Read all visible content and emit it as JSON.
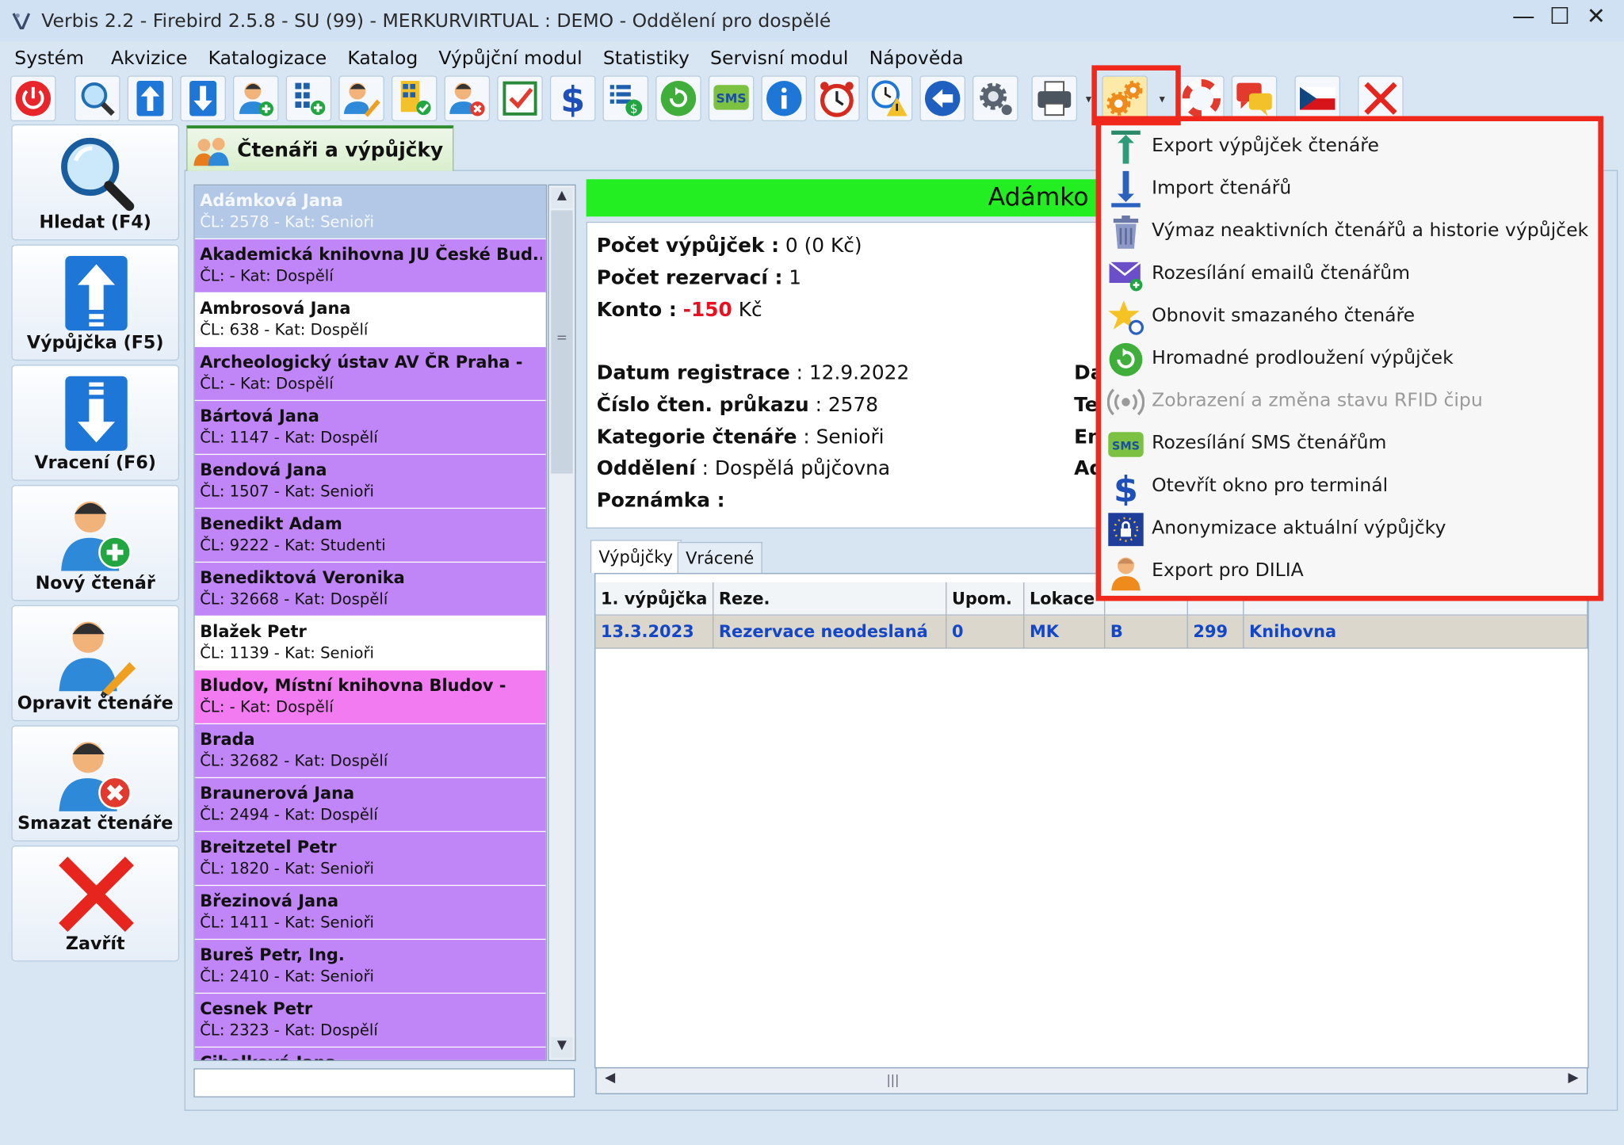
{
  "window": {
    "title": "Verbis 2.2 - Firebird 2.5.8 - SU (99) - MERKURVIRTUAL : DEMO - Oddělení pro dospělé",
    "controls": [
      "—",
      "☐",
      "✕"
    ]
  },
  "menubar": [
    "Systém",
    "Akvizice",
    "Katalogizace",
    "Katalog",
    "Výpůjční modul",
    "Statistiky",
    "Servisní modul",
    "Nápověda"
  ],
  "toolbar": {
    "sms_label": "SMS",
    "icons": [
      "power-icon",
      "search-icon",
      "upload-icon",
      "download-icon",
      "add-user-icon",
      "add-list-icon",
      "edit-user-icon",
      "list-check-icon",
      "remove-user-icon",
      "checkbox-icon",
      "dollar-icon",
      "list-money-icon",
      "refresh-icon",
      "sms-icon",
      "info-icon",
      "alarm-clock-icon",
      "warning-clock-icon",
      "back-arrow-icon",
      "settings-gear-icon",
      "printer-icon",
      "gears-icon",
      "lifebuoy-icon",
      "chat-icon",
      "czech-flag-icon",
      "close-icon"
    ]
  },
  "nav": [
    {
      "label": "Hledat (F4)"
    },
    {
      "label": "Výpůjčka (F5)"
    },
    {
      "label": "Vracení (F6)"
    },
    {
      "label": "Nový čtenář"
    },
    {
      "label": "Opravit čtenáře"
    },
    {
      "label": "Smazat čtenáře"
    },
    {
      "label": "Zavřít"
    }
  ],
  "content_tab": {
    "label": "Čtenáři a výpůjčky"
  },
  "readers": [
    {
      "name": "Adámková Jana",
      "sub": "ČL: 2578 - Kat: Senioři",
      "style": "sel"
    },
    {
      "name": "Akademická knihovna JU České Bud...",
      "sub": "ČL:  - Kat: Dospělí",
      "style": "violet"
    },
    {
      "name": "Ambrosová Jana",
      "sub": "ČL: 638 - Kat: Dospělí",
      "style": "white"
    },
    {
      "name": "Archeologický ústav AV ČR Praha -",
      "sub": "ČL:  - Kat: Dospělí",
      "style": "violet"
    },
    {
      "name": "Bártová Jana",
      "sub": "ČL: 1147 - Kat: Dospělí",
      "style": "violet"
    },
    {
      "name": "Bendová Jana",
      "sub": "ČL: 1507 - Kat: Senioři",
      "style": "violet"
    },
    {
      "name": "Benedikt Adam",
      "sub": "ČL: 9222 - Kat: Studenti",
      "style": "violet"
    },
    {
      "name": "Benediktová Veronika",
      "sub": "ČL: 32668 - Kat: Dospělí",
      "style": "violet"
    },
    {
      "name": "Blažek Petr",
      "sub": "ČL: 1139 - Kat: Senioři",
      "style": "white"
    },
    {
      "name": "Bludov, Místní knihovna Bludov -",
      "sub": "ČL:  - Kat: Dospělí",
      "style": "pink"
    },
    {
      "name": "Brada",
      "sub": "ČL: 32682 - Kat: Dospělí",
      "style": "violet"
    },
    {
      "name": "Braunerová Jana",
      "sub": "ČL: 2494 - Kat: Dospělí",
      "style": "violet"
    },
    {
      "name": "Breitzetel Petr",
      "sub": "ČL: 1820 - Kat: Senioři",
      "style": "violet"
    },
    {
      "name": "Březinová Jana",
      "sub": "ČL: 1411 - Kat: Senioři",
      "style": "violet"
    },
    {
      "name": "Bureš Petr, Ing.",
      "sub": "ČL: 2410 - Kat: Senioři",
      "style": "violet"
    },
    {
      "name": "Cesnek Petr",
      "sub": "ČL: 2323 - Kat: Dospělí",
      "style": "violet"
    },
    {
      "name": "Cihelková Jana",
      "sub": "",
      "style": "violet"
    }
  ],
  "list_scroll_mid": "=",
  "reader_header": "Adámko",
  "detail": {
    "pocet_vypujcek_label": "Počet výpůjček :",
    "pocet_vypujcek_value": "0    (0 Kč)",
    "pocet_rezervaci_label": "Počet rezervací :",
    "pocet_rezervaci_value": "1",
    "konto_label": "Konto :",
    "konto_value": "-150",
    "konto_unit": "Kč",
    "datum_registrace_label": "Datum registrace",
    "datum_registrace_value": ": 12.9.2022",
    "cislo_prukazu_label": "Číslo čten. průkazu",
    "cislo_prukazu_value": ": 2578",
    "kategorie_label": "Kategorie čtenáře",
    "kategorie_value": ": Senioři",
    "oddeleni_label": "Oddělení",
    "oddeleni_value": ": Dospělá půjčovna",
    "poznamka_label": "Poznámka :",
    "cut_labels": [
      "Da",
      "Te",
      "Em",
      "Ad"
    ]
  },
  "subtabs": [
    "Výpůjčky",
    "Vrácené"
  ],
  "loans_table": {
    "headers": [
      "1. výpůjčka",
      "Reze.",
      "Upom.",
      "Lokace",
      "",
      "",
      ""
    ],
    "rows": [
      [
        "13.3.2023",
        "Rezervace neodeslaná",
        "0",
        "MK",
        "B",
        "299",
        "Knihovna"
      ]
    ]
  },
  "hscroll_mid": "|||",
  "dropdown": [
    {
      "label": "Export výpůjček čtenáře",
      "icon": "export-arrow-icon",
      "enabled": true
    },
    {
      "label": "Import čtenářů",
      "icon": "import-arrow-icon",
      "enabled": true
    },
    {
      "label": "Výmaz neaktivních čtenářů a historie výpůjček",
      "icon": "trash-icon",
      "enabled": true
    },
    {
      "label": "Rozesílání emailů čtenářům",
      "icon": "email-add-icon",
      "enabled": true
    },
    {
      "label": "Obnovit smazaného čtenáře",
      "icon": "star-restore-icon",
      "enabled": true
    },
    {
      "label": "Hromadné prodloužení výpůjček",
      "icon": "refresh-green-icon",
      "enabled": true
    },
    {
      "label": "Zobrazení a změna stavu RFID čipu",
      "icon": "rfid-icon",
      "enabled": false
    },
    {
      "label": "Rozesílání SMS čtenářům",
      "icon": "sms-icon",
      "enabled": true
    },
    {
      "label": "Otevřít okno pro terminál",
      "icon": "dollar-icon",
      "enabled": true
    },
    {
      "label": "Anonymizace aktuální výpůjčky",
      "icon": "eu-lock-icon",
      "enabled": true
    },
    {
      "label": "Export pro DILIA",
      "icon": "person-icon",
      "enabled": true
    }
  ],
  "colors": {
    "violet": "#c085f6",
    "pink": "#f37bf2",
    "selected": "#b3c8e6",
    "header_green": "#22ee22",
    "highlight_red": "#f0281c",
    "link_blue": "#1446c8"
  }
}
